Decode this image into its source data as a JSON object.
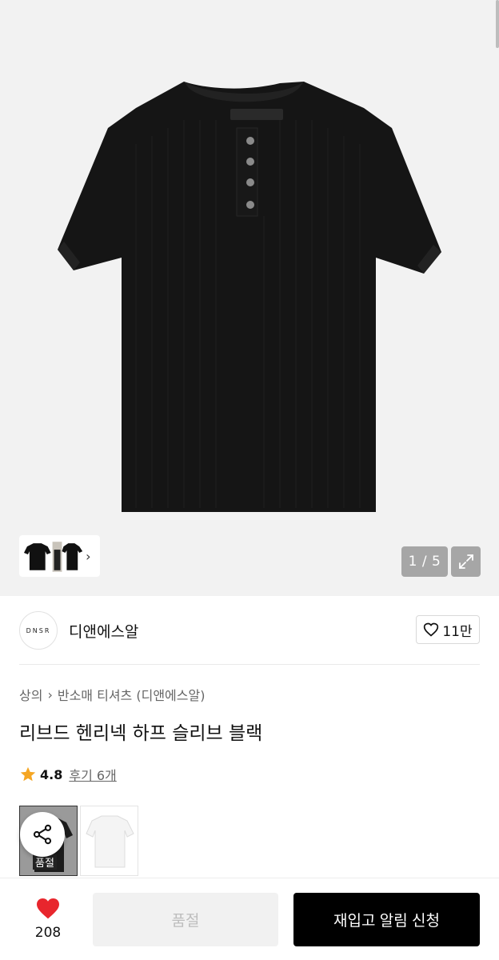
{
  "gallery": {
    "counter": "1 / 5",
    "image_alt": "black henley short sleeve t-shirt"
  },
  "brand": {
    "logo_text": "DNSR",
    "name": "디앤에스알",
    "likes": "11만"
  },
  "product": {
    "breadcrumb": [
      "상의",
      "반소매 티셔츠 (디앤에스알)"
    ],
    "title": "리브드 헨리넥 하프 슬리브 블랙",
    "rating": "4.8",
    "review_label": "후기 6개"
  },
  "options": {
    "soldout_tag": "품절"
  },
  "bottom_bar": {
    "heart_count": "208",
    "soldout_button": "품절",
    "restock_button": "재입고 알림 신청"
  },
  "colors": {
    "accent_red": "#e8262d",
    "star": "#f5a623",
    "primary_button": "#000000"
  }
}
